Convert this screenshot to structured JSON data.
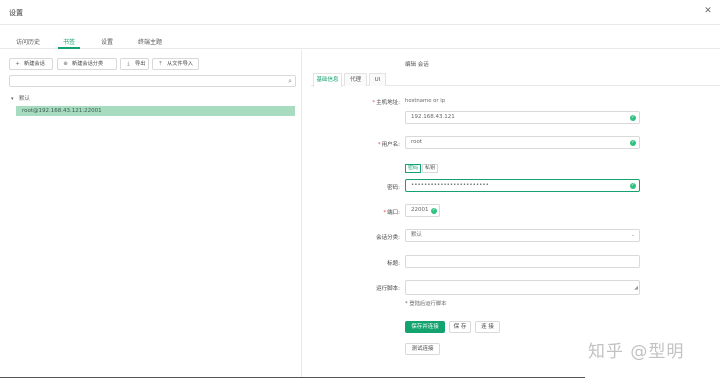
{
  "window": {
    "title": "设置",
    "close_glyph": "✕"
  },
  "tabs": [
    {
      "label": "访问历史",
      "active": false
    },
    {
      "label": "书签",
      "active": true
    },
    {
      "label": "设置",
      "active": false
    },
    {
      "label": "终端主题",
      "active": false
    }
  ],
  "toolbar": {
    "new_session": "新建会话",
    "new_category": "新建会话分类",
    "export": "导出",
    "import": "从文件导入"
  },
  "search": {
    "placeholder": "",
    "value": ""
  },
  "tree": {
    "root_label": "默认",
    "items": [
      {
        "label": "root@192.168.43.121:22001",
        "selected": true
      }
    ]
  },
  "panel": {
    "title": "编辑 会话",
    "sub_tabs": [
      {
        "label": "基础信息",
        "active": true
      },
      {
        "label": "代理",
        "active": false
      },
      {
        "label": "UI",
        "active": false
      }
    ]
  },
  "form": {
    "host_label": "主机地址:",
    "host_hint": "hostname or ip",
    "host_value": "192.168.43.121",
    "user_label": "用户名:",
    "user_value": "root",
    "auth_password": "密码",
    "auth_key": "私钥",
    "password_label": "密码:",
    "password_value": "••••••••••••••••••••••••",
    "port_label": "端口:",
    "port_value": "22001",
    "category_label": "会话分类:",
    "category_value": "默认",
    "title_label": "标题:",
    "title_value": "",
    "script_label": "运行脚本:",
    "script_value": "",
    "script_hint": "* 登陆后运行脚本"
  },
  "actions": {
    "save_connect": "保存并连接",
    "save": "保 存",
    "connect": "连 接",
    "test": "测试连接"
  },
  "watermark": "知乎 @型明",
  "colors": {
    "accent": "#13a36e",
    "selection": "#a7dcc1",
    "ok": "#2ec27e",
    "required": "#e5484d"
  },
  "icons": {
    "close": "close-icon",
    "plus": "plus-icon",
    "plus_circle": "plus-circle-icon",
    "export": "export-icon",
    "import": "import-icon",
    "search": "search-icon",
    "check": "check-circle-icon",
    "chevron": "chevron-down-icon"
  }
}
